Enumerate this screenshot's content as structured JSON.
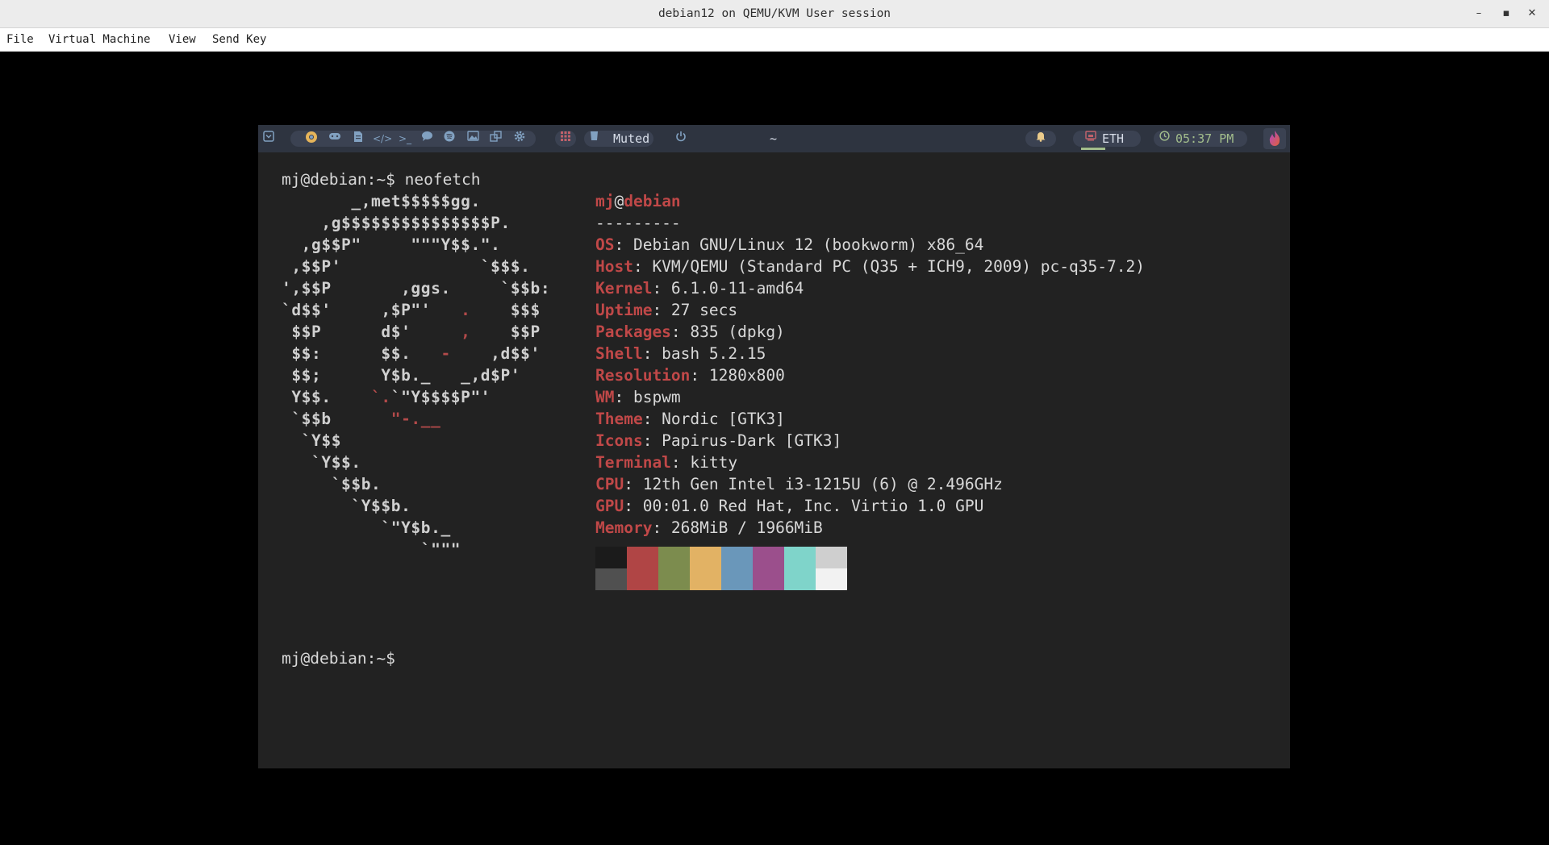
{
  "window": {
    "title": "debian12 on QEMU/KVM User session",
    "minimize_glyph": "–",
    "maximize_glyph": "▪",
    "close_glyph": "✕"
  },
  "menu": [
    "File",
    "Virtual Machine",
    "View",
    "Send Key"
  ],
  "polybar": {
    "menu_icon": "dropdown-icon",
    "apps": [
      "chrome-icon",
      "gamepad-icon",
      "file-icon",
      "code-icon",
      "terminal-icon",
      "chat-icon",
      "spotify-icon",
      "image-icon",
      "windows-icon",
      "settings-icon"
    ],
    "code_glyph": "</>",
    "term_glyph": ">_",
    "volume": "Muted",
    "workspace": "~",
    "network": "ETH",
    "clock": "05:37 PM",
    "accent": "#81a1c1",
    "network_underline": "#a3be8c"
  },
  "terminal": {
    "prompt_cmd": "mj@debian:~$ neofetch",
    "prompt_end": "mj@debian:~$",
    "ascii": [
      "       _,met$$$$$gg.",
      "    ,g$$$$$$$$$$$$$$$P.",
      "  ,g$$P\"     \"\"\"Y$$.\".",
      " ,$$P'              `$$$.",
      "',$$P       ,ggs.     `$$b:",
      "`d$$'     ,$P\"'   .    $$$",
      " $$P      d$'     ,    $$P",
      " $$:      $$.   -    ,d$$'",
      " $$;      Y$b._   _,d$P'",
      " Y$$.    `.`\"Y$$$$P\"'",
      " `$$b      \"-.__",
      "  `Y$$",
      "   `Y$$.",
      "     `$$b.",
      "       `Y$$b.",
      "          `\"Y$b._",
      "              `\"\"\""
    ],
    "user": "mj",
    "at": "@",
    "host": "debian",
    "separator": "---------",
    "info": [
      {
        "key": "OS",
        "value": ": Debian GNU/Linux 12 (bookworm) x86_64"
      },
      {
        "key": "Host",
        "value": ": KVM/QEMU (Standard PC (Q35 + ICH9, 2009) pc-q35-7.2)"
      },
      {
        "key": "Kernel",
        "value": ": 6.1.0-11-amd64"
      },
      {
        "key": "Uptime",
        "value": ": 27 secs"
      },
      {
        "key": "Packages",
        "value": ": 835 (dpkg)"
      },
      {
        "key": "Shell",
        "value": ": bash 5.2.15"
      },
      {
        "key": "Resolution",
        "value": ": 1280x800"
      },
      {
        "key": "WM",
        "value": ": bspwm"
      },
      {
        "key": "Theme",
        "value": ": Nordic [GTK3]"
      },
      {
        "key": "Icons",
        "value": ": Papirus-Dark [GTK3]"
      },
      {
        "key": "Terminal",
        "value": ": kitty"
      },
      {
        "key": "CPU",
        "value": ": 12th Gen Intel i3-1215U (6) @ 2.496GHz"
      },
      {
        "key": "GPU",
        "value": ": 00:01.0 Red Hat, Inc. Virtio 1.0 GPU"
      },
      {
        "key": "Memory",
        "value": ": 268MiB / 1966MiB"
      }
    ],
    "palette_top": [
      "#1b1b1b",
      "#b04545",
      "#7c8c4e",
      "#e2b264",
      "#6a97ba",
      "#9b4f8c",
      "#7fd4ca",
      "#cfcfcf"
    ],
    "palette_bottom": [
      "#505050",
      "#b04545",
      "#7c8c4e",
      "#e2b264",
      "#6a97ba",
      "#9b4f8c",
      "#7fd4ca",
      "#f2f2f2"
    ]
  }
}
